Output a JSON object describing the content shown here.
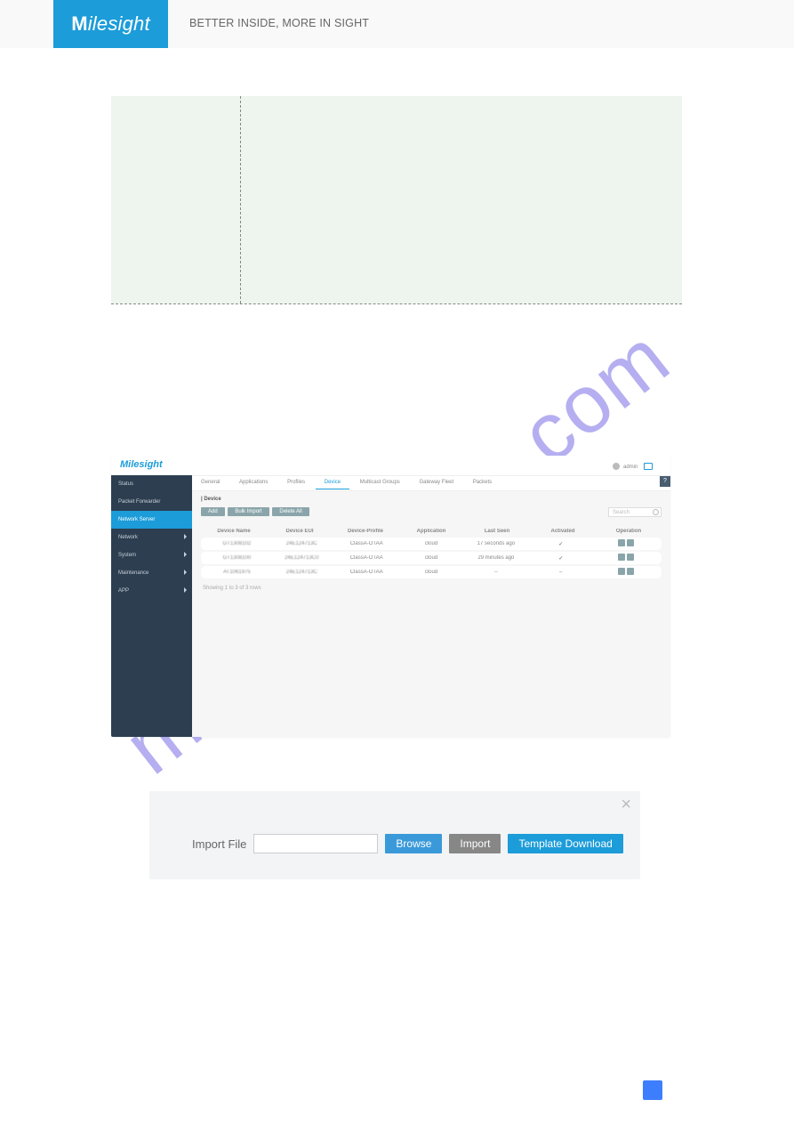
{
  "header": {
    "brand": "Milesight",
    "tagline": "BETTER INSIDE, MORE IN SIGHT"
  },
  "watermark": "manualshive.com",
  "mini": {
    "brand": "Milesight",
    "admin": "admin",
    "sidebar": [
      "Status",
      "Packet Forwarder",
      "Network Server",
      "Network",
      "System",
      "Maintenance",
      "APP"
    ],
    "tabs": [
      "General",
      "Applications",
      "Profiles",
      "Device",
      "Multicast Groups",
      "Gateway Fleet",
      "Packets"
    ],
    "active_tab": "Device",
    "help": "?",
    "section": "| Device",
    "actions": {
      "add": "Add",
      "bulk": "Bulk Import",
      "delall": "Delete All"
    },
    "search_placeholder": "Search",
    "columns": [
      "Device Name",
      "Device EUI",
      "Device-Profile",
      "Application",
      "Last Seen",
      "Activated",
      "Operation"
    ],
    "rows": [
      {
        "name": "GT1308102",
        "eui": "24E124713C",
        "profile": "ClassA-OTAA",
        "app": "cloud",
        "last": "17 seconds ago",
        "act": "✓"
      },
      {
        "name": "GT1308100",
        "eui": "24E124713C0",
        "profile": "ClassA-OTAA",
        "app": "cloud",
        "last": "29 minutes ago",
        "act": "✓"
      },
      {
        "name": "AT1061975",
        "eui": "24E124713C",
        "profile": "ClassA-OTAA",
        "app": "cloud",
        "last": "–",
        "act": "–"
      }
    ],
    "showing": "Showing 1 to 3 of 3 rows"
  },
  "import": {
    "label": "Import File",
    "browse": "Browse",
    "import": "Import",
    "template": "Template Download"
  }
}
